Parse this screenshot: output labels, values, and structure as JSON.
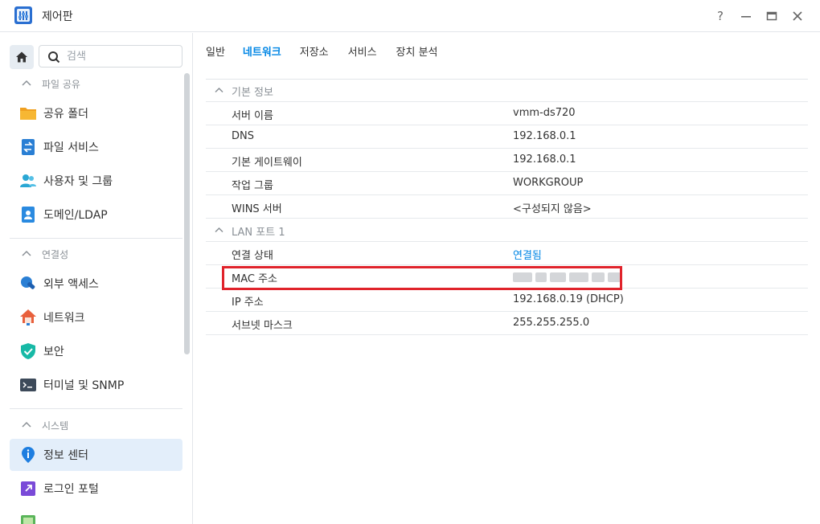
{
  "window": {
    "title": "제어판",
    "help_label": "?",
    "minimize_label": "—",
    "maximize_label": "▭",
    "close_label": "✕"
  },
  "search": {
    "placeholder": "검색"
  },
  "sidebar": {
    "sections": [
      {
        "title": "파일 공유",
        "items": [
          {
            "label": "공유 폴더",
            "icon": "folder-icon"
          },
          {
            "label": "파일 서비스",
            "icon": "file-services-icon"
          },
          {
            "label": "사용자 및 그룹",
            "icon": "users-icon"
          },
          {
            "label": "도메인/LDAP",
            "icon": "domain-icon"
          }
        ]
      },
      {
        "title": "연결성",
        "items": [
          {
            "label": "외부 액세스",
            "icon": "external-access-icon"
          },
          {
            "label": "네트워크",
            "icon": "network-icon"
          },
          {
            "label": "보안",
            "icon": "shield-icon"
          },
          {
            "label": "터미널 및 SNMP",
            "icon": "terminal-icon"
          }
        ]
      },
      {
        "title": "시스템",
        "items": [
          {
            "label": "정보 센터",
            "icon": "info-icon",
            "active": true
          },
          {
            "label": "로그인 포털",
            "icon": "login-portal-icon"
          }
        ]
      }
    ]
  },
  "tabs": [
    {
      "label": "일반"
    },
    {
      "label": "네트워크",
      "active": true
    },
    {
      "label": "저장소"
    },
    {
      "label": "서비스"
    },
    {
      "label": "장치 분석"
    }
  ],
  "groups": {
    "basic": {
      "title": "기본 정보",
      "rows": [
        {
          "key": "서버 이름",
          "value": "vmm-ds720"
        },
        {
          "key": "DNS",
          "value": "192.168.0.1"
        },
        {
          "key": "기본 게이트웨이",
          "value": "192.168.0.1"
        },
        {
          "key": "작업 그룹",
          "value": "WORKGROUP"
        },
        {
          "key": "WINS 서버",
          "value": "<구성되지 않음>"
        }
      ]
    },
    "lan": {
      "title": "LAN 포트 1",
      "rows": [
        {
          "key": "연결 상태",
          "value": "연결됨"
        },
        {
          "key": "MAC 주소",
          "value": ""
        },
        {
          "key": "IP 주소",
          "value": "192.168.0.19 (DHCP)"
        },
        {
          "key": "서브넷 마스크",
          "value": "255.255.255.0"
        }
      ]
    }
  },
  "colors": {
    "accent": "#0086e5",
    "active_bg": "#e3eefa",
    "highlight": "#e0232b"
  }
}
